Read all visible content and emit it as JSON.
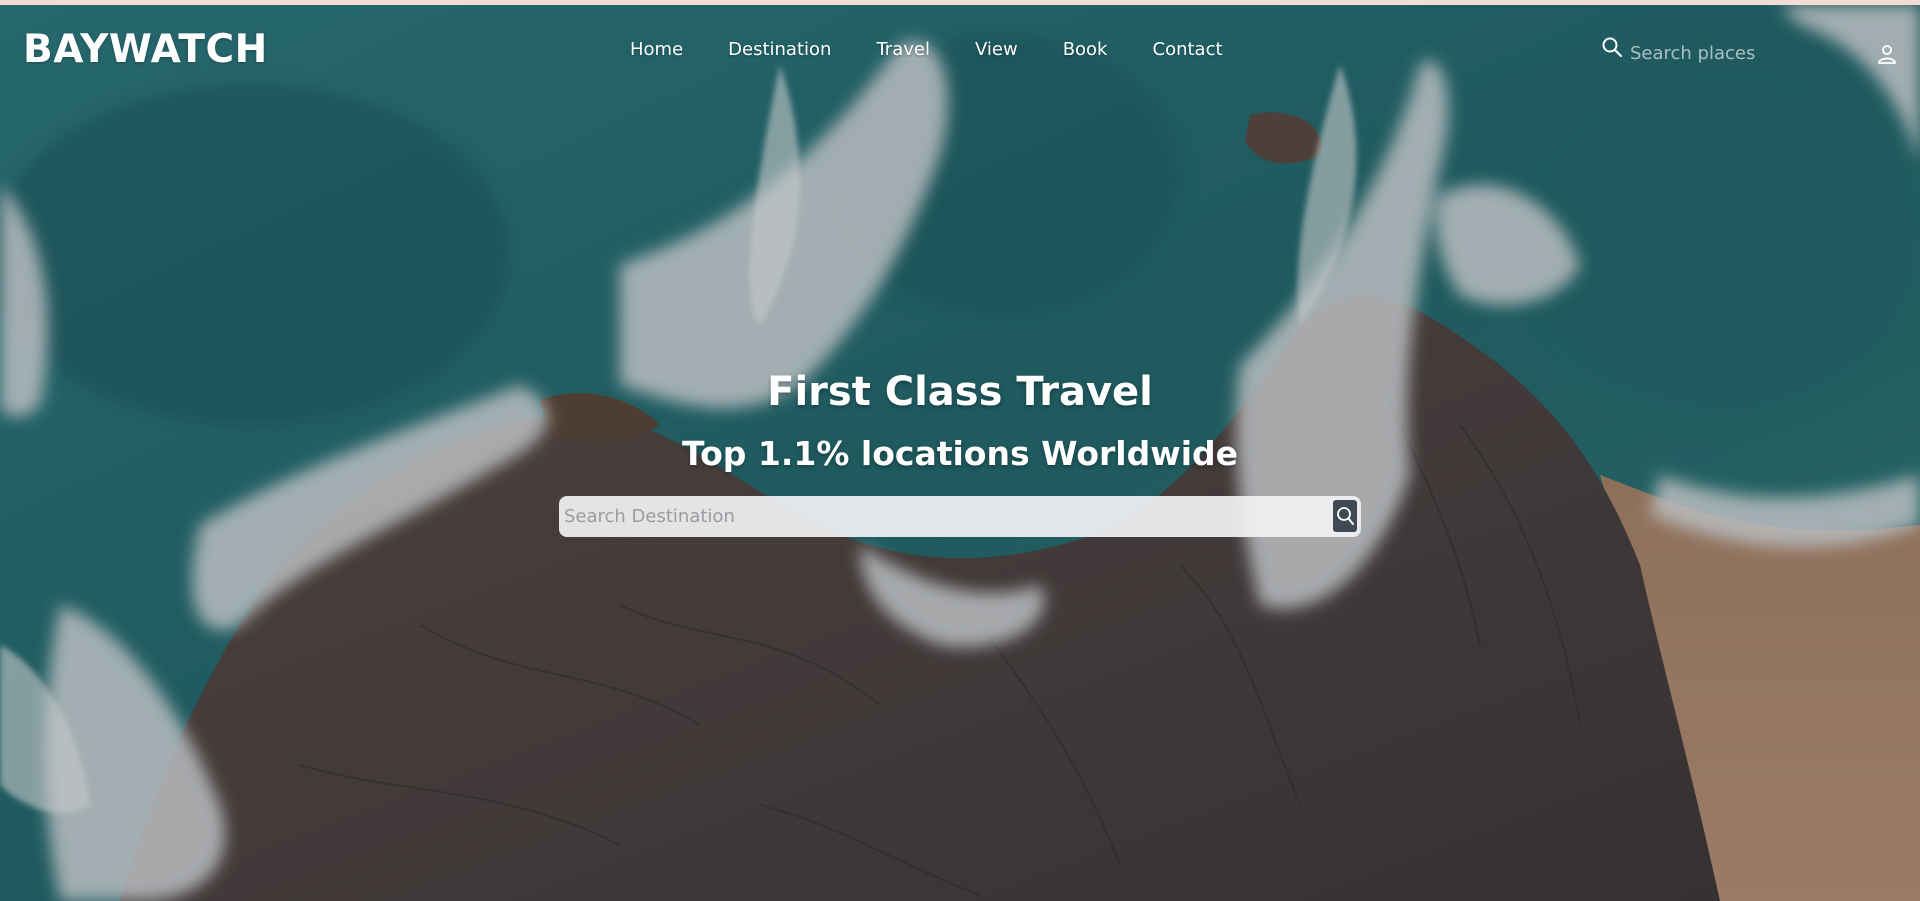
{
  "header": {
    "logo": "BAYWATCH",
    "nav": [
      {
        "label": "Home"
      },
      {
        "label": "Destination"
      },
      {
        "label": "Travel"
      },
      {
        "label": "View"
      },
      {
        "label": "Book"
      },
      {
        "label": "Contact"
      }
    ],
    "search": {
      "placeholder": "Search places",
      "icon": "search-icon"
    },
    "user_icon": "user-icon"
  },
  "hero": {
    "title": "First Class Travel",
    "subtitle": "Top 1.1% locations Worldwide",
    "search": {
      "placeholder": "Search Destination",
      "icon": "search-icon"
    }
  },
  "colors": {
    "top_strip": "#f2dcd6",
    "ocean": "#2c6f72",
    "rock": "#4e4540",
    "sand": "#b0876c",
    "foam": "#d9dde0",
    "search_button": "#3f4a55"
  }
}
